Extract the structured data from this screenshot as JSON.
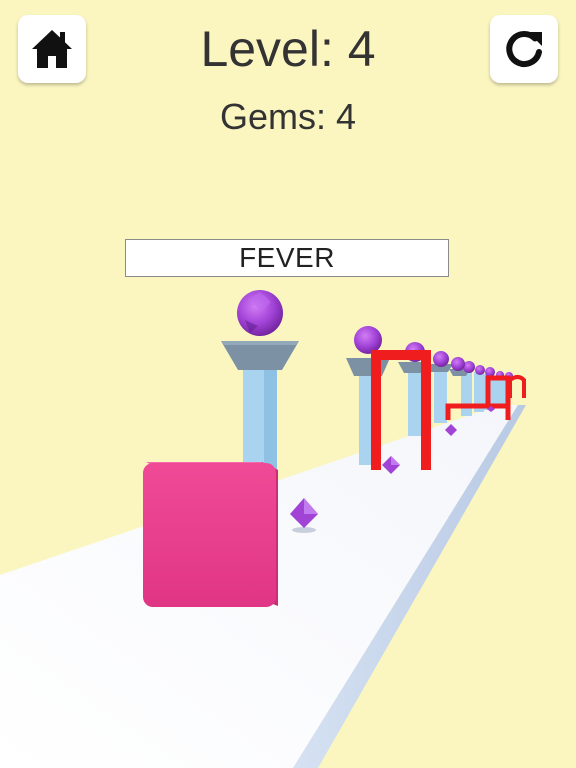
{
  "hud": {
    "level_text": "Level: 4",
    "gems_text": "Gems: 4",
    "home_icon": "home-icon",
    "restart_icon": "restart-icon"
  },
  "fever": {
    "label": "FEVER",
    "progress": 0,
    "fill_color": "#ff7a1a"
  },
  "colors": {
    "background": "#fbf6c0",
    "player_cube": "#ec3d8e",
    "gates": "#ef1d1d",
    "gems": "#a144d6",
    "pillars": "#a9d3ef",
    "track": "#ffffff"
  }
}
